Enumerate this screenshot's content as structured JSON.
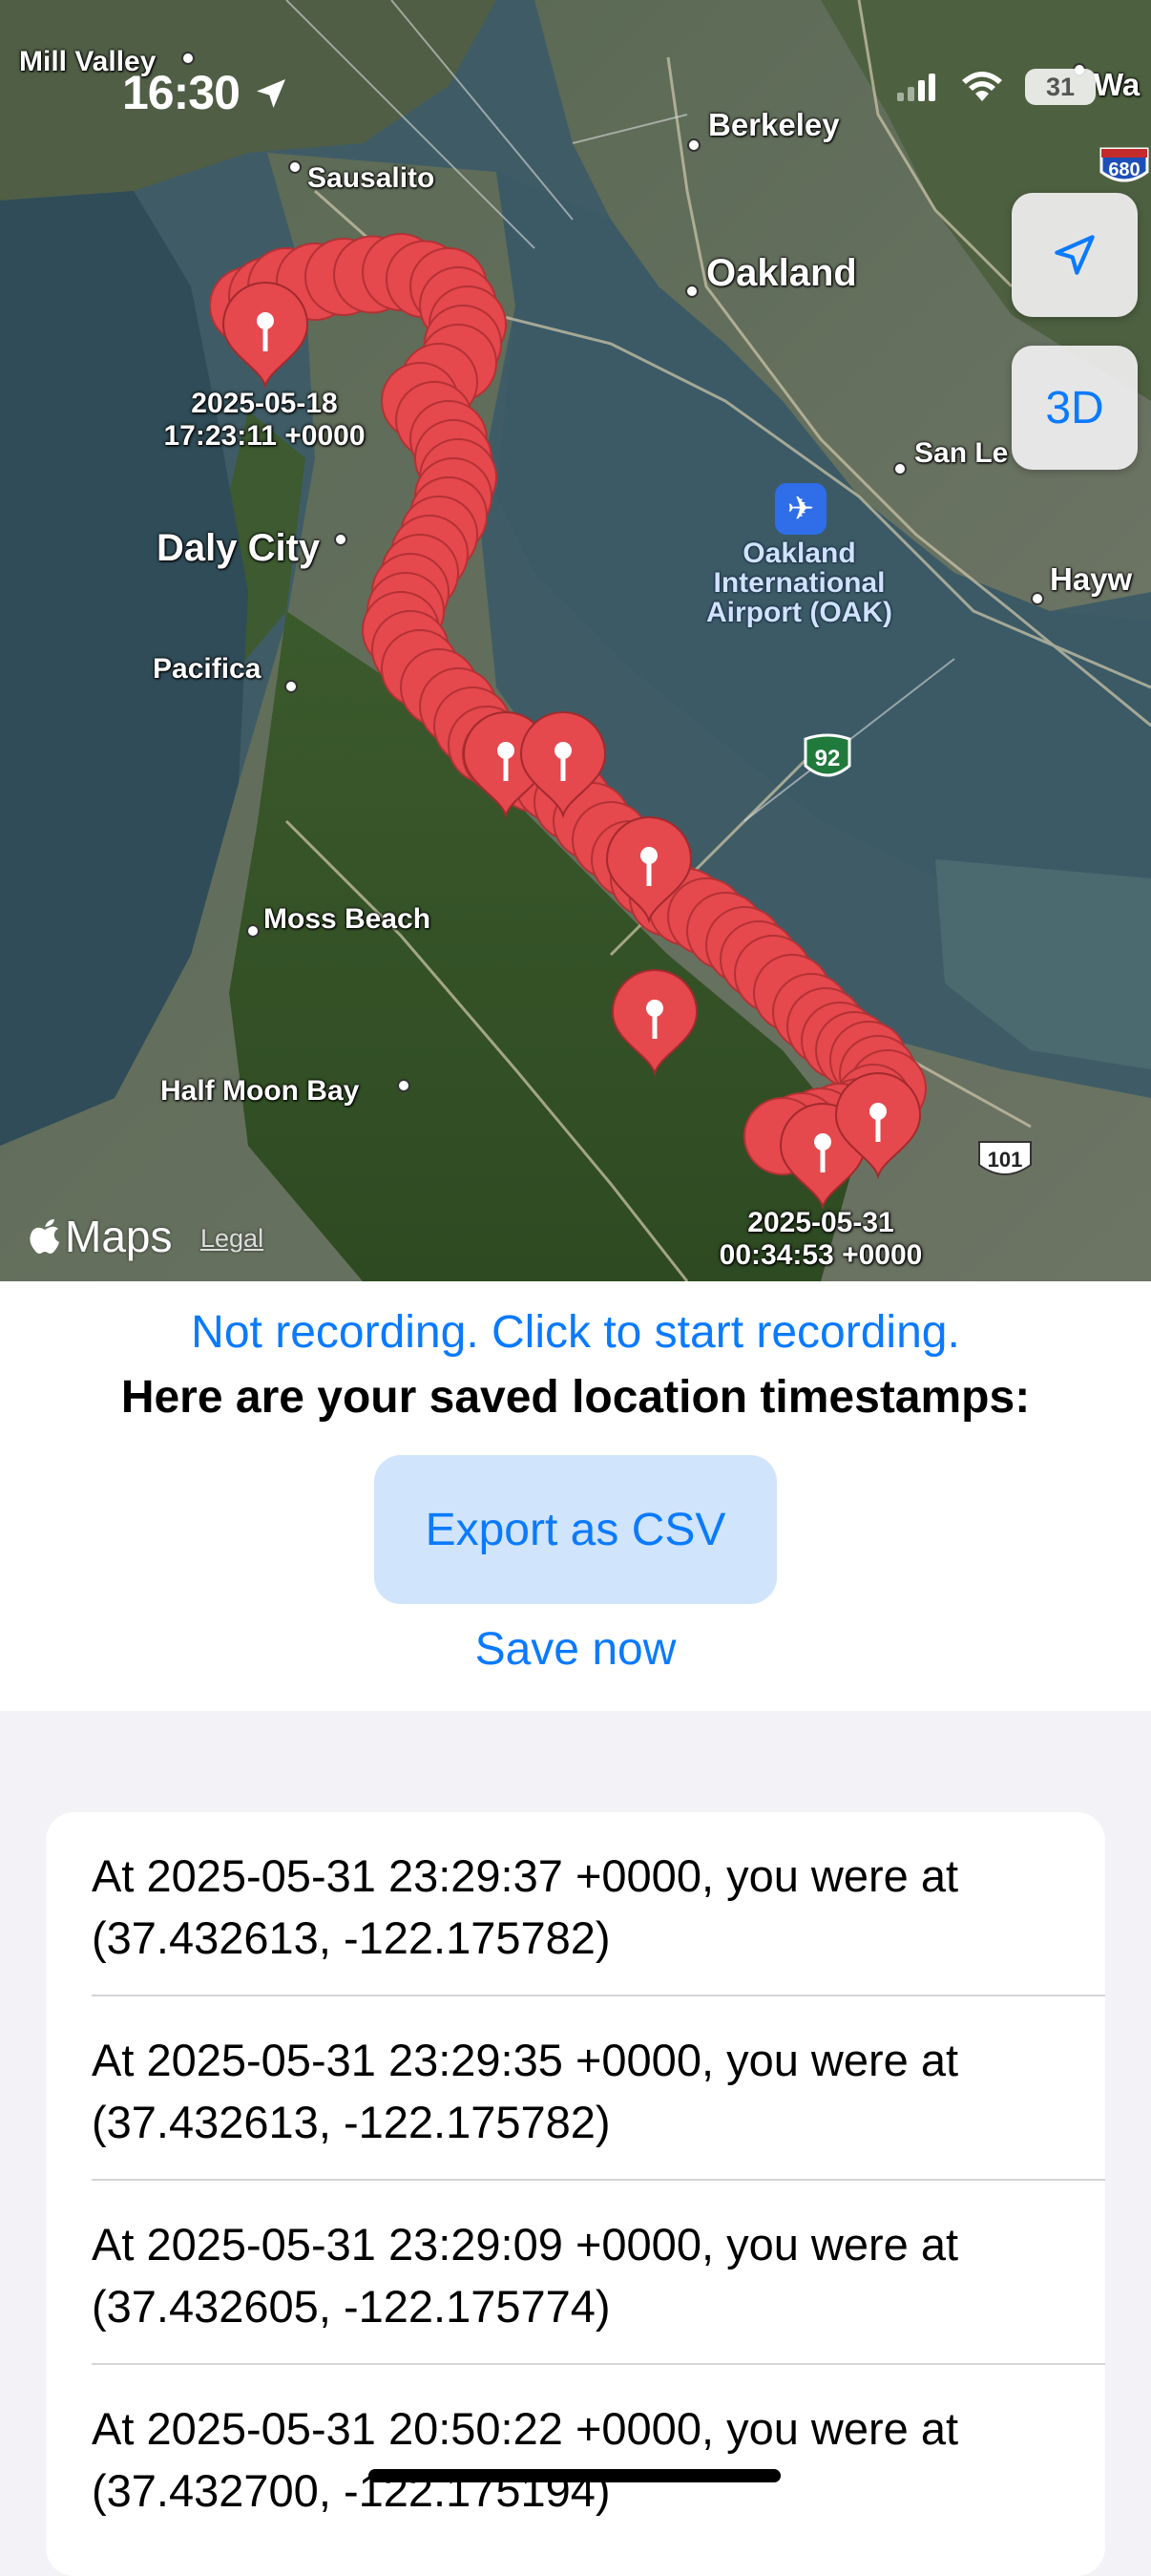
{
  "status_bar": {
    "time": "16:30",
    "battery": "31"
  },
  "map": {
    "places": [
      {
        "name": "Mill Valley",
        "size": "small"
      },
      {
        "name": "Sausalito",
        "size": "small"
      },
      {
        "name": "Berkeley",
        "size": "mid"
      },
      {
        "name": "Oakland",
        "size": "big"
      },
      {
        "name": "San Le",
        "size": "small"
      },
      {
        "name": "Daly City",
        "size": "big"
      },
      {
        "name": "Pacifica",
        "size": "small"
      },
      {
        "name": "Hayw",
        "size": "mid"
      },
      {
        "name": "Moss Beach",
        "size": "small"
      },
      {
        "name": "Half Moon Bay",
        "size": "small"
      },
      {
        "name": "Wa",
        "size": "mid"
      }
    ],
    "airport": "Oakland\nInternational\nAirport (OAK)",
    "highway_shields": [
      "92",
      "101",
      "680"
    ],
    "start_pin": "2025-05-18\n17:23:11 +0000",
    "end_pin": "2025-05-31\n00:34:53 +0000",
    "btn_3d": "3D",
    "attribution": "Maps",
    "legal": "Legal",
    "pin_color": "#e5484d"
  },
  "controls": {
    "record_link": "Not recording. Click to start recording.",
    "heading": "Here are your saved location timestamps:",
    "export_button": "Export as CSV",
    "save_now": "Save now"
  },
  "list": {
    "rows": [
      "At 2025-05-31 23:29:37 +0000, you were at (37.432613, -122.175782)",
      "At 2025-05-31 23:29:35 +0000, you were at (37.432613, -122.175782)",
      "At 2025-05-31 23:29:09 +0000, you were at (37.432605, -122.175774)",
      "At 2025-05-31 20:50:22 +0000, you were at (37.432700, -122.175194)"
    ]
  }
}
